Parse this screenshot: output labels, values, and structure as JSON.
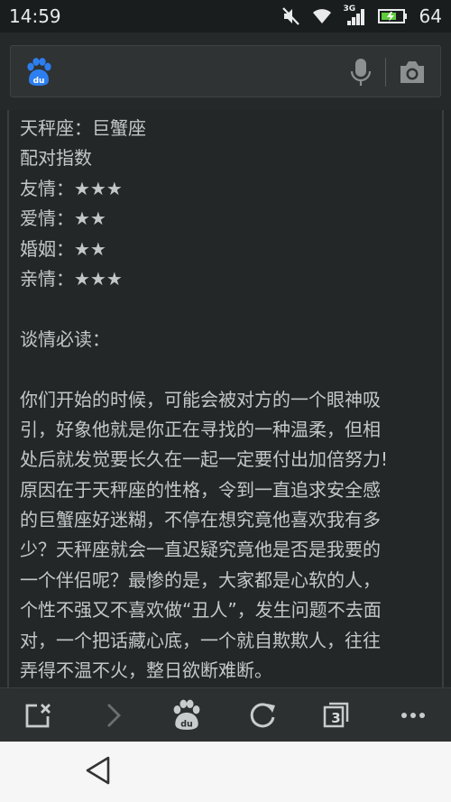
{
  "status": {
    "time": "14:59",
    "network": "3G",
    "battery": "64"
  },
  "search": {
    "logo_text": "du",
    "placeholder": ""
  },
  "content": {
    "lines": [
      "天秤座：巨蟹座",
      "配对指数",
      "友情：★★★",
      "爱情：★★",
      "婚姻：★★",
      "亲情：★★★"
    ],
    "section_title": "谈情必读：",
    "paragraph": [
      "你们开始的时候，可能会被对方的一个眼神吸",
      "引，好象他就是你正在寻找的一种温柔，但相",
      "处后就发觉要长久在一起一定要付出加倍努力!",
      "原因在于天秤座的性格，令到一直追求安全感",
      "的巨蟹座好迷糊，不停在想究竟他喜欢我有多",
      "少？天秤座就会一直迟疑究竟他是否是我要的",
      "一个伴侣呢？最惨的是，大家都是心软的人，",
      "个性不强又不喜欢做“丑人”，发生问题不去面",
      "对，一个把话藏心底，一个就自欺欺人，往往",
      "弄得不温不火，整日欲断难断。"
    ]
  },
  "bottom_nav": {
    "tab_count": "3",
    "logo_text": "du"
  },
  "colors": {
    "background": "#242728",
    "text": "#c4c7c8",
    "battery_accent": "#5ecb3a",
    "system_nav": "#f6f6f6"
  },
  "icons": {
    "status": [
      "mute-icon",
      "wifi-icon",
      "signal-icon",
      "battery-icon"
    ],
    "search": [
      "baidu-logo-icon",
      "microphone-icon",
      "camera-icon"
    ],
    "bottom_nav": [
      "close-page-icon",
      "forward-arrow-icon",
      "baidu-paw-icon",
      "refresh-icon",
      "tabs-icon",
      "more-icon"
    ],
    "system": [
      "back-triangle-icon"
    ]
  }
}
